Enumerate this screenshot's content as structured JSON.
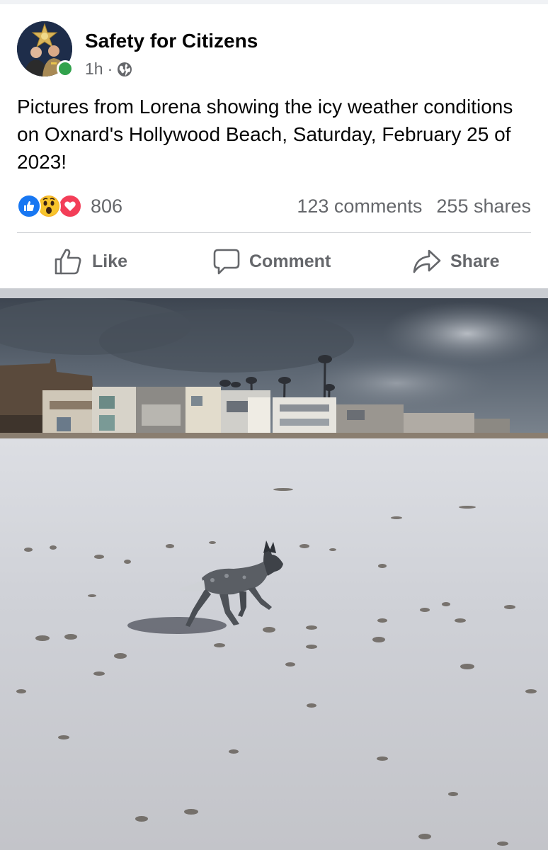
{
  "post": {
    "page_name": "Safety for Citizens",
    "time": "1h",
    "separator_dot": "·",
    "privacy_icon": "globe-icon",
    "text": "Pictures from Lorena showing the icy weather conditions on Oxnard's Hollywood Beach, Saturday, February 25 of 2023!"
  },
  "engagement": {
    "reaction_icons": [
      "like-reaction-icon",
      "wow-reaction-icon",
      "love-reaction-icon"
    ],
    "reaction_count": "806",
    "comments": "123 comments",
    "shares": "255 shares"
  },
  "actions": {
    "like": "Like",
    "comment": "Comment",
    "share": "Share"
  },
  "colors": {
    "like_blue": "#1877f2",
    "wow_yellow": "#f7b125",
    "love_red": "#f33e58",
    "online_green": "#31a24c",
    "secondary_text": "#65676b"
  }
}
